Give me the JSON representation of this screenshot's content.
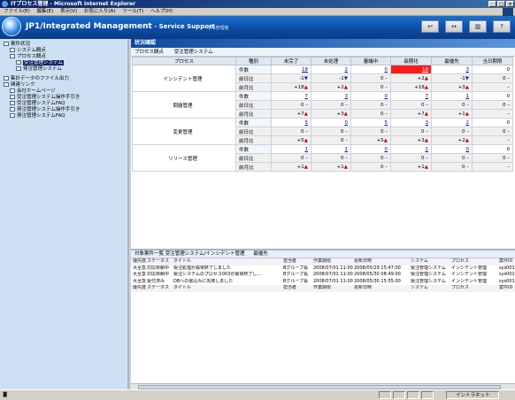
{
  "window": {
    "title": "ITプロセス管理 - Microsoft Internet Explorer",
    "menu": [
      "ファイル(E)",
      "編集(E)",
      "表示(V)",
      "お気に入り(A)",
      "ツール(T)",
      "ヘルプ(H)"
    ]
  },
  "header": {
    "title": "JP1/Integrated Management",
    "subtitle": " - Service Support",
    "user": "JP1管理者",
    "buttons": [
      "↩",
      "↔",
      "▥",
      "?"
    ]
  },
  "sidebar": {
    "items": [
      {
        "label": "案件状況",
        "indent": 0
      },
      {
        "label": "システム観点",
        "indent": 1
      },
      {
        "label": "プロセス観点",
        "indent": 1
      },
      {
        "label": "受注管理システム",
        "indent": 2,
        "selected": true
      },
      {
        "label": "発注管理システム",
        "indent": 2
      },
      {
        "label": "集計データのファイル出力",
        "indent": 0
      },
      {
        "label": "関連リンク",
        "indent": 0
      },
      {
        "label": "会社ホームページ",
        "indent": 1
      },
      {
        "label": "受注管理システム操作手引き",
        "indent": 1
      },
      {
        "label": "受注管理システムFAQ",
        "indent": 1
      },
      {
        "label": "発注管理システム操作手引き",
        "indent": 1
      },
      {
        "label": "発注管理システムFAQ",
        "indent": 1
      }
    ]
  },
  "status_panel": {
    "title": "状況確認",
    "crumb_view": "プロセス観点",
    "crumb_system": "受注管理システム",
    "columns": [
      "プロセス",
      "種別",
      "未完了",
      "未処理",
      "審議中",
      "長期化",
      "最優先",
      "当日期限"
    ],
    "row_kinds": [
      "件数",
      "前日比",
      "前月比"
    ],
    "processes": [
      {
        "name": "インシデント管理",
        "counts": [
          "18",
          "2",
          "0",
          "18",
          "3",
          "0"
        ],
        "day": [
          "-1▼",
          "-1▼",
          "0 –",
          "+2▲",
          "-1▼",
          "0 –"
        ],
        "month": [
          "+18▲",
          "+2▲",
          "0 –",
          "+18▲",
          "+3▲",
          "–"
        ]
      },
      {
        "name": "問題管理",
        "counts": [
          "7",
          "3",
          "0",
          "7",
          "1",
          "0"
        ],
        "day": [
          "0 –",
          "0 –",
          "0 –",
          "0 –",
          "0 –",
          "0 –"
        ],
        "month": [
          "+7▲",
          "+3▲",
          "0 –",
          "+7▲",
          "+1▲",
          "–"
        ]
      },
      {
        "name": "変更管理",
        "counts": [
          "5",
          "0",
          "5",
          "3",
          "2",
          "0"
        ],
        "day": [
          "0 –",
          "0 –",
          "0 –",
          "0 –",
          "0 –",
          "0 –"
        ],
        "month": [
          "+5▲",
          "0 –",
          "+5▲",
          "+3▲",
          "+2▲",
          "–"
        ]
      },
      {
        "name": "リリース管理",
        "counts": [
          "1",
          "1",
          "0",
          "1",
          "0",
          "0"
        ],
        "day": [
          "0 –",
          "0 –",
          "0 –",
          "0 –",
          "0 –",
          "0 –"
        ],
        "month": [
          "+1▲",
          "+1▲",
          "0 –",
          "+1▲",
          "0 –",
          "–"
        ]
      }
    ],
    "highlight": {
      "process": 0,
      "col": 3,
      "color": "#ff1a1a"
    }
  },
  "list_panel": {
    "title": "対象案件一覧 受注管理システム/インシデント管理",
    "sort_label": "最優先",
    "columns": [
      "優先度",
      "ステータス",
      "タイトル",
      "担当者",
      "作業期限",
      "更新日時",
      "システム",
      "プロセス",
      "案件ID"
    ],
    "rows": [
      [
        "大至急",
        "対応依頼中",
        "受注処理が異常終了しました",
        "Bグループ長",
        "2008/07/01 11:00",
        "2008/05/29 15:47:00",
        "受注管理システム",
        "インシデント管理",
        "sys001-inci"
      ],
      [
        "大至急",
        "対応依頼中",
        "受注システムのプロセス003が異常終了し...",
        "Bグループ長",
        "2008/07/01 11:00",
        "2008/05/30 08:49:00",
        "受注管理システム",
        "インシデント管理",
        "sys001-inci"
      ],
      [
        "大至急",
        "受付済み",
        "DBへの書込みに失敗しました",
        "Bグループ長",
        "2008/07/01 11:00",
        "2008/05/30 15:55:00",
        "受注管理システム",
        "インシデント管理",
        "sys001-inci"
      ]
    ]
  },
  "statusbar": {
    "zone": "イントラネット"
  }
}
